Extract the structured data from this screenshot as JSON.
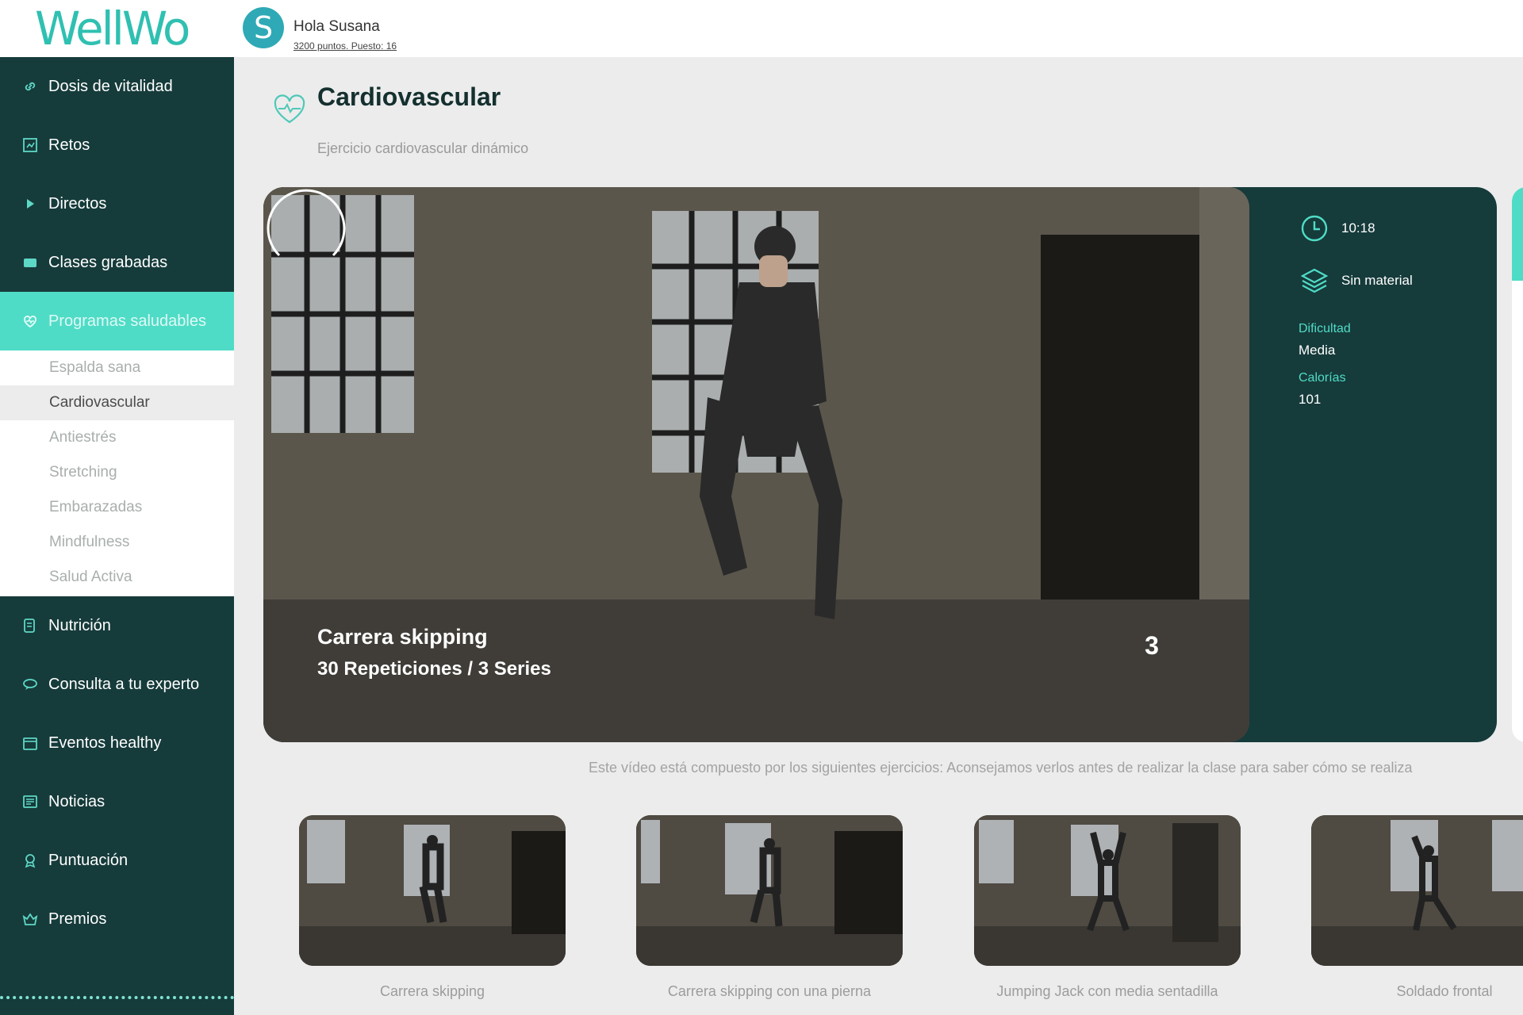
{
  "header": {
    "logo": "WellWo",
    "avatar_letter": "S",
    "greeting": "Hola Susana",
    "points": "3200 puntos. Puesto: 16"
  },
  "sidebar": {
    "items": [
      {
        "label": "Dosis de vitalidad",
        "icon": "link-icon"
      },
      {
        "label": "Retos",
        "icon": "challenge-icon"
      },
      {
        "label": "Directos",
        "icon": "play-icon"
      },
      {
        "label": "Clases grabadas",
        "icon": "video-icon"
      },
      {
        "label": "Programas saludables",
        "icon": "heart-icon"
      },
      {
        "label": "Nutrición",
        "icon": "nutrition-icon"
      },
      {
        "label": "Consulta a tu experto",
        "icon": "chat-icon"
      },
      {
        "label": "Eventos healthy",
        "icon": "calendar-icon"
      },
      {
        "label": "Noticias",
        "icon": "news-icon"
      },
      {
        "label": "Puntuación",
        "icon": "award-icon"
      },
      {
        "label": "Premios",
        "icon": "crown-icon"
      }
    ],
    "subitems": [
      "Espalda sana",
      "Cardiovascular",
      "Antiestrés",
      "Stretching",
      "Embarazadas",
      "Mindfulness",
      "Salud Activa"
    ]
  },
  "main": {
    "title": "Cardiovascular",
    "subtitle": "Ejercicio cardiovascular dinámico",
    "video": {
      "exercise": "Carrera skipping",
      "reps": "30 Repeticiones / 3 Series",
      "countdown": "3"
    },
    "info": {
      "duration": "10:18",
      "material": "Sin material",
      "difficulty_label": "Dificultad",
      "difficulty": "Media",
      "calories_label": "Calorías",
      "calories": "101"
    },
    "note": "Este vídeo está compuesto por los siguientes ejercicios: Aconsejamos verlos antes de realizar la clase para saber cómo se realiza",
    "exercises": [
      "Carrera skipping",
      "Carrera skipping con una pierna",
      "Jumping Jack con media sentadilla",
      "Soldado frontal"
    ]
  },
  "colors": {
    "sidebar": "#163b3b",
    "accent": "#4fdcc6",
    "logo": "#2fc0b1",
    "background": "#ececec"
  }
}
